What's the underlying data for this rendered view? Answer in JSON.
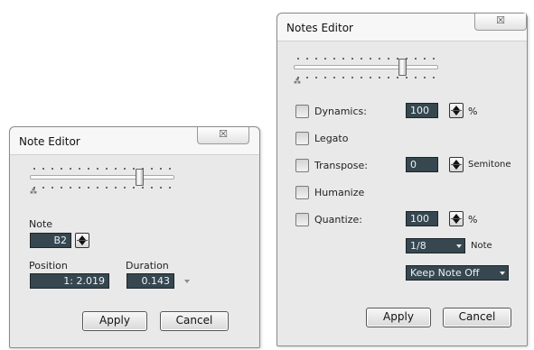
{
  "note_editor": {
    "title": "Note Editor",
    "close_icon_glyph": "☒",
    "note_label": "Note",
    "note_value": "B2",
    "position_label": "Position",
    "position_value": "1: 2.019",
    "duration_label": "Duration",
    "duration_value": "0.143",
    "apply_label": "Apply",
    "cancel_label": "Cancel",
    "slider_min_mark": "⁂"
  },
  "notes_editor": {
    "title": "Notes Editor",
    "close_icon_glyph": "☒",
    "slider_min_mark": "⁂",
    "options": {
      "dynamics": {
        "label": "Dynamics:",
        "value": "100",
        "unit": "%"
      },
      "legato": {
        "label": "Legato"
      },
      "transpose": {
        "label": "Transpose:",
        "value": "0",
        "unit": "Semitone"
      },
      "humanize": {
        "label": "Humanize"
      },
      "quantize": {
        "label": "Quantize:",
        "value": "100",
        "unit": "%",
        "grid_value": "1/8",
        "grid_unit": "Note",
        "note_off_value": "Keep Note Off"
      }
    },
    "apply_label": "Apply",
    "cancel_label": "Cancel"
  },
  "colors": {
    "field_bg": "#37474f",
    "field_text": "#e9f3fb",
    "dialog_bg": "#e9e9e9"
  },
  "icons": [
    "close-icon",
    "spin-up-icon",
    "spin-down-icon",
    "dropdown-arrow-icon"
  ]
}
